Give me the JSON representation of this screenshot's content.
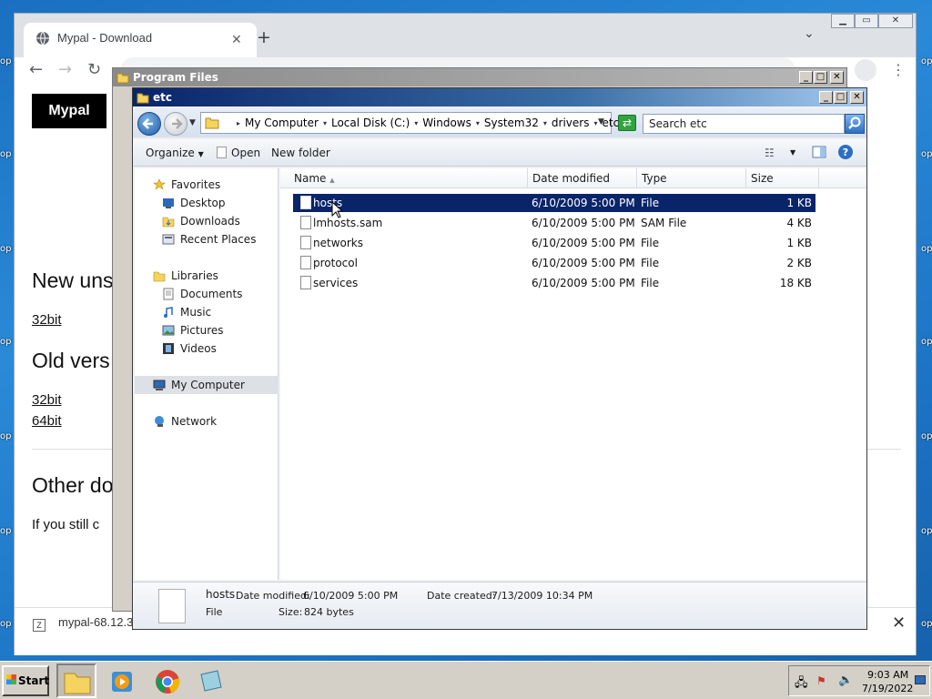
{
  "browser": {
    "tab_title": "Mypal - Download",
    "page": {
      "logo": "Mypal",
      "heading_new": "New uns",
      "link_32bit_new": "32bit",
      "heading_old": "Old vers",
      "link_32bit_old": "32bit",
      "link_64bit_old": "64bit",
      "heading_other": "Other do",
      "paragraph": "If you still c"
    },
    "download_item": "mypal-68.12.3"
  },
  "program_files_window": {
    "title": "Program Files"
  },
  "explorer": {
    "title": "etc",
    "breadcrumbs": [
      "My Computer",
      "Local Disk (C:)",
      "Windows",
      "System32",
      "drivers",
      "etc"
    ],
    "search_placeholder": "Search etc",
    "commands": {
      "organize": "Organize",
      "open": "Open",
      "new_folder": "New folder"
    },
    "nav": {
      "favorites": "Favorites",
      "desktop": "Desktop",
      "downloads": "Downloads",
      "recent_places": "Recent Places",
      "libraries": "Libraries",
      "documents": "Documents",
      "music": "Music",
      "pictures": "Pictures",
      "videos": "Videos",
      "my_computer": "My Computer",
      "network": "Network"
    },
    "columns": {
      "name": "Name",
      "date_modified": "Date modified",
      "type": "Type",
      "size": "Size"
    },
    "files": [
      {
        "name": "hosts",
        "date": "6/10/2009 5:00 PM",
        "type": "File",
        "size": "1 KB"
      },
      {
        "name": "lmhosts.sam",
        "date": "6/10/2009 5:00 PM",
        "type": "SAM File",
        "size": "4 KB"
      },
      {
        "name": "networks",
        "date": "6/10/2009 5:00 PM",
        "type": "File",
        "size": "1 KB"
      },
      {
        "name": "protocol",
        "date": "6/10/2009 5:00 PM",
        "type": "File",
        "size": "2 KB"
      },
      {
        "name": "services",
        "date": "6/10/2009 5:00 PM",
        "type": "File",
        "size": "18 KB"
      }
    ],
    "details": {
      "name": "hosts",
      "date_modified_label": "Date modified:",
      "date_modified": "6/10/2009 5:00 PM",
      "date_created_label": "Date created:",
      "date_created": "7/13/2009 10:34 PM",
      "type": "File",
      "size_label": "Size:",
      "size": "824 bytes"
    }
  },
  "taskbar": {
    "start": "Start",
    "time": "9:03 AM",
    "date": "7/19/2022"
  },
  "desktop": {
    "edge_label": "op"
  }
}
